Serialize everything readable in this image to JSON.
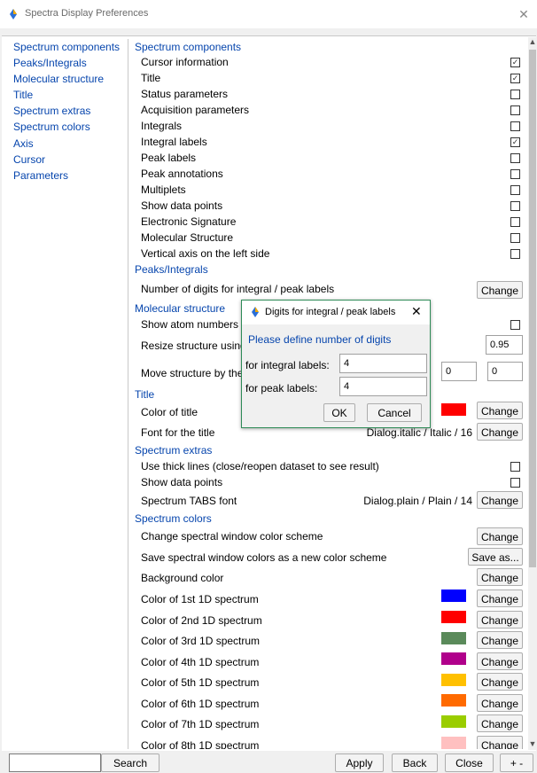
{
  "window": {
    "title": "Spectra Display Preferences",
    "close_glyph": "✕"
  },
  "sidebar": {
    "items": [
      {
        "label": "Spectrum components"
      },
      {
        "label": "Peaks/Integrals"
      },
      {
        "label": "Molecular structure"
      },
      {
        "label": "Title"
      },
      {
        "label": "Spectrum extras"
      },
      {
        "label": "Spectrum colors"
      },
      {
        "label": "Axis"
      },
      {
        "label": "Cursor"
      },
      {
        "label": "Parameters"
      }
    ]
  },
  "sections": {
    "components": {
      "header": "Spectrum components",
      "items": [
        {
          "label": "Cursor information",
          "checked": true
        },
        {
          "label": "Title",
          "checked": true
        },
        {
          "label": "Status parameters",
          "checked": false
        },
        {
          "label": "Acquisition parameters",
          "checked": false
        },
        {
          "label": "Integrals",
          "checked": false
        },
        {
          "label": "Integral labels",
          "checked": true
        },
        {
          "label": "Peak labels",
          "checked": false
        },
        {
          "label": "Peak annotations",
          "checked": false
        },
        {
          "label": "Multiplets",
          "checked": false
        },
        {
          "label": "Show data points",
          "checked": false
        },
        {
          "label": "Electronic Signature",
          "checked": false
        },
        {
          "label": "Molecular Structure",
          "checked": false
        },
        {
          "label": "Vertical axis on the left side",
          "checked": false
        }
      ]
    },
    "peaks": {
      "header": "Peaks/Integrals",
      "digits_label": "Number of digits for integral / peak labels",
      "change_label": "Change"
    },
    "molecular": {
      "header": "Molecular structure",
      "show_atom_label": "Show atom numbers",
      "resize_label": "Resize structure using",
      "resize_value": "0.95",
      "move_label": "Move structure by the",
      "move_x": "0",
      "move_y": "0"
    },
    "title": {
      "header": "Title",
      "color_label": "Color of title",
      "color": "#ff0000",
      "font_label": "Font for the title",
      "font_value": "Dialog.italic / Italic / 16",
      "change_label": "Change"
    },
    "extras": {
      "header": "Spectrum extras",
      "thick_lines_label": "Use thick lines (close/reopen dataset to see result)",
      "show_points_label": "Show data points",
      "tabs_font_label": "Spectrum TABS font",
      "tabs_font_value": "Dialog.plain / Plain / 14",
      "change_label": "Change"
    },
    "colors": {
      "header": "Spectrum colors",
      "scheme_label": "Change spectral window color scheme",
      "save_label": "Save spectral window colors as a new color scheme",
      "save_button": "Save as...",
      "change_label": "Change",
      "items": [
        {
          "label": "Background color",
          "color": "#ffffff"
        },
        {
          "label": "Color of 1st 1D spectrum",
          "color": "#0000ff"
        },
        {
          "label": "Color of 2nd 1D spectrum",
          "color": "#ff0000"
        },
        {
          "label": "Color of 3rd 1D spectrum",
          "color": "#5a8a5a"
        },
        {
          "label": "Color of 4th 1D spectrum",
          "color": "#b0008b"
        },
        {
          "label": "Color of 5th 1D spectrum",
          "color": "#ffc000"
        },
        {
          "label": "Color of 6th 1D spectrum",
          "color": "#ff6a00"
        },
        {
          "label": "Color of 7th 1D spectrum",
          "color": "#9acd00"
        },
        {
          "label": "Color of 8th 1D spectrum",
          "color": "#ffc0c0"
        }
      ]
    }
  },
  "dialog": {
    "title": "Digits for integral / peak labels",
    "close_glyph": "✕",
    "prompt": "Please define number of digits",
    "integral_label": "for integral labels:",
    "integral_value": "4",
    "peak_label": "for peak labels:",
    "peak_value": "4",
    "ok": "OK",
    "cancel": "Cancel"
  },
  "bottom": {
    "search_button": "Search",
    "apply": "Apply",
    "back": "Back",
    "close": "Close",
    "plusminus": "+ -"
  }
}
